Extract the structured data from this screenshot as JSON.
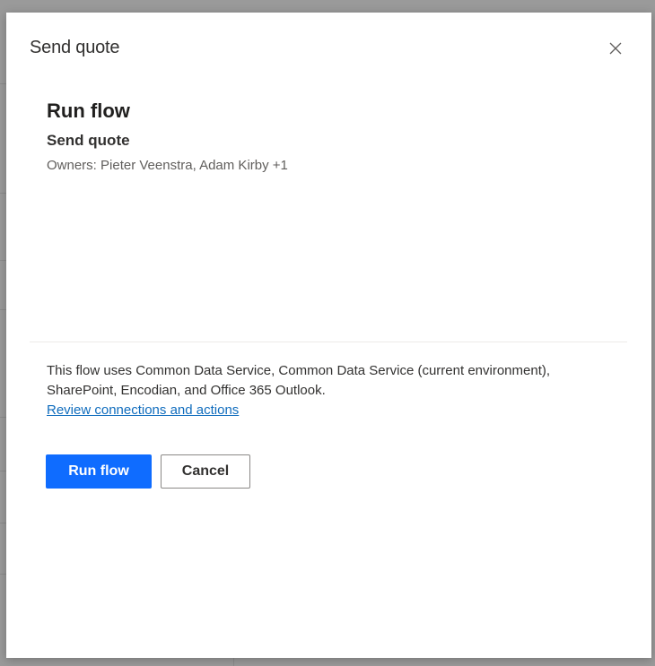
{
  "dialog": {
    "title": "Send quote",
    "close_icon": "close-icon"
  },
  "content": {
    "heading": "Run flow",
    "flow_name": "Send quote",
    "owners": "Owners: Pieter Veenstra, Adam Kirby +1"
  },
  "info": {
    "text_line1": "This flow uses Common Data Service, Common Data Service (current environment),",
    "text_line2": "SharePoint, Encodian, and Office 365 Outlook.",
    "link": "Review connections and actions"
  },
  "actions": {
    "primary_label": "Run flow",
    "secondary_label": "Cancel"
  },
  "colors": {
    "primary": "#0f6cff",
    "link": "#0f6cbd"
  }
}
